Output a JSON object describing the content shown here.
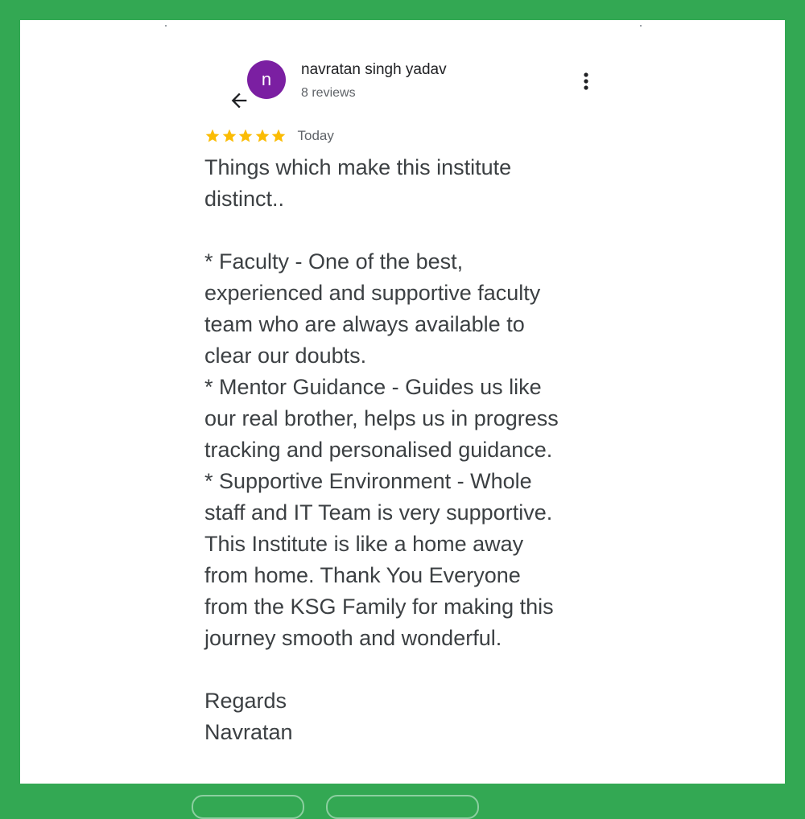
{
  "header": {
    "avatar_letter": "n",
    "reviewer_name": "navratan singh yadav",
    "review_count": "8 reviews",
    "back_icon": "arrow-left-icon",
    "more_icon": "more-vert-icon"
  },
  "rating": {
    "stars": 5,
    "max_stars": 5,
    "date": "Today",
    "star_color": "#fbbc04"
  },
  "review": {
    "paragraphs": [
      [
        "Things which make this institute",
        "distinct.."
      ],
      [
        "* Faculty - One of the best,",
        "experienced and supportive faculty",
        "team who are always available to",
        "clear our doubts.",
        "* Mentor Guidance - Guides us like",
        "our real brother, helps us in progress",
        "tracking and personalised guidance.",
        "* Supportive Environment - Whole",
        "staff and IT Team is very supportive.",
        "This Institute is like a home away",
        "from home. Thank You Everyone",
        "from the KSG Family for making this",
        "journey smooth and wonderful."
      ],
      [
        "Regards",
        "Navratan"
      ]
    ]
  },
  "colors": {
    "frame": "#33a853",
    "avatar": "#7b1fa2",
    "text": "#3c4043"
  }
}
